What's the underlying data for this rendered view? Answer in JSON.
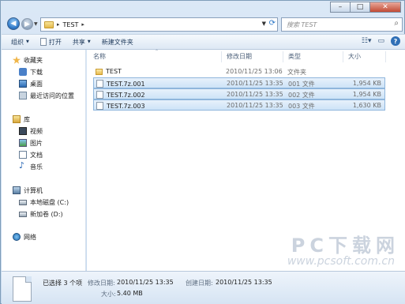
{
  "window": {
    "controls": {
      "minimize": "–",
      "maximize": "□",
      "close": "✕"
    }
  },
  "address": {
    "path": "TEST",
    "separator": "▸"
  },
  "search": {
    "placeholder": "搜索 TEST"
  },
  "toolbar": {
    "organize": "组织",
    "open": "打开",
    "share": "共享",
    "new_folder": "新建文件夹"
  },
  "columns": {
    "name": "名称",
    "date": "修改日期",
    "type": "类型",
    "size": "大小"
  },
  "nav": {
    "favorites": "收藏夹",
    "downloads": "下载",
    "desktop": "桌面",
    "recent": "最近访问的位置",
    "libraries": "库",
    "videos": "视频",
    "pictures": "图片",
    "documents": "文档",
    "music": "音乐",
    "computer": "计算机",
    "drive_c": "本地磁盘 (C:)",
    "drive_d": "新加卷 (D:)",
    "network": "网络"
  },
  "files": [
    {
      "name": "TEST",
      "date": "2010/11/25 13:06",
      "type": "文件夹",
      "size": "",
      "kind": "folder",
      "selected": false
    },
    {
      "name": "TEST.7z.001",
      "date": "2010/11/25 13:35",
      "type": "001 文件",
      "size": "1,954 KB",
      "kind": "file",
      "selected": true
    },
    {
      "name": "TEST.7z.002",
      "date": "2010/11/25 13:35",
      "type": "002 文件",
      "size": "1,954 KB",
      "kind": "file",
      "selected": true
    },
    {
      "name": "TEST.7z.003",
      "date": "2010/11/25 13:35",
      "type": "003 文件",
      "size": "1,630 KB",
      "kind": "file",
      "selected": true
    }
  ],
  "details": {
    "selected_count": "已选择 3 个项",
    "modified_label": "修改日期:",
    "modified_value": "2010/11/25 13:35",
    "created_label": "创建日期:",
    "created_value": "2010/11/25 13:35",
    "size_label": "大小:",
    "size_value": "5.40 MB"
  },
  "watermark": {
    "logo": "PC下载网",
    "url": "www.pcsoft.com.cn"
  }
}
